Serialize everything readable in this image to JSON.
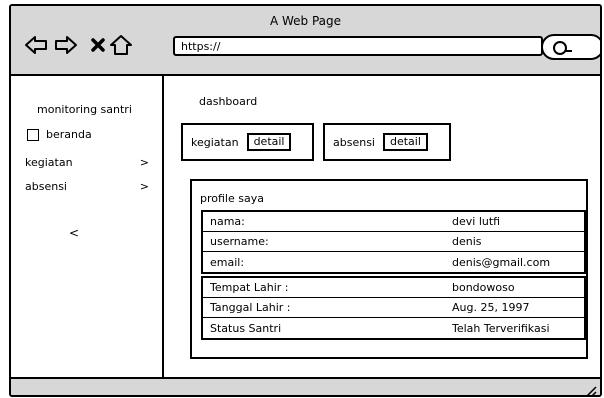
{
  "window": {
    "title": "A Web Page"
  },
  "toolbar": {
    "back_icon": "back-arrow-icon",
    "forward_icon": "forward-arrow-icon",
    "close_icon": "close-icon",
    "home_icon": "home-icon",
    "url": "https://",
    "search_icon": "search-icon"
  },
  "sidebar": {
    "title": "monitoring santri",
    "checkbox_item": {
      "label": "beranda",
      "checked": false
    },
    "items": [
      {
        "label": "kegiatan",
        "chevron": ">"
      },
      {
        "label": "absensi",
        "chevron": ">"
      }
    ],
    "collapse_label": "<"
  },
  "main": {
    "title": "dashboard",
    "cards": [
      {
        "label": "kegiatan",
        "button": "detail"
      },
      {
        "label": "absensi",
        "button": "detail"
      }
    ],
    "profile": {
      "title": "profile saya",
      "group1": [
        {
          "label": "nama:",
          "value": "devi lutfi"
        },
        {
          "label": "username:",
          "value": "denis"
        },
        {
          "label": "email:",
          "value": "denis@gmail.com"
        }
      ],
      "group2": [
        {
          "label": "Tempat Lahir :",
          "value": "bondowoso"
        },
        {
          "label": "Tanggal Lahir :",
          "value": "Aug. 25, 1997"
        },
        {
          "label": "Status Santri",
          "value": "Telah Terverifikasi"
        }
      ]
    }
  }
}
